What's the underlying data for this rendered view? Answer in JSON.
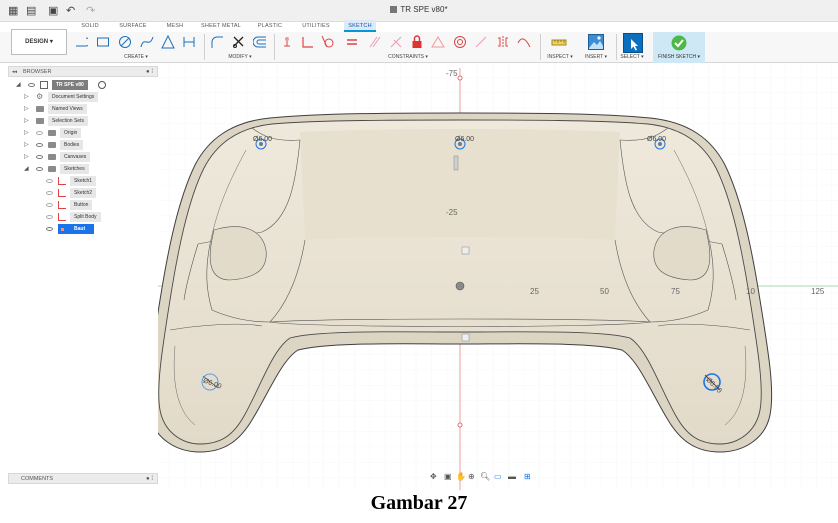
{
  "app": {
    "document_title": "TR SPE v80*",
    "design_label": "DESIGN"
  },
  "tabs": [
    {
      "label": "SOLID",
      "active": false
    },
    {
      "label": "SURFACE",
      "active": false
    },
    {
      "label": "MESH",
      "active": false
    },
    {
      "label": "SHEET METAL",
      "active": false
    },
    {
      "label": "PLASTIC",
      "active": false
    },
    {
      "label": "UTILITIES",
      "active": false
    },
    {
      "label": "SKETCH",
      "active": true
    }
  ],
  "toolbar_groups": {
    "create": "CREATE",
    "modify": "MODIFY",
    "constraints": "CONSTRAINTS",
    "inspect": "INSPECT",
    "insert": "INSERT",
    "select": "SELECT",
    "finish_sketch": "FINISH SKETCH"
  },
  "browser": {
    "title": "BROWSER",
    "root": "TR SPE v80",
    "items": [
      {
        "label": "Document Settings",
        "icon": "gear-icon"
      },
      {
        "label": "Named Views",
        "icon": "folder-icon"
      },
      {
        "label": "Selection Sets",
        "icon": "folder-icon"
      },
      {
        "label": "Origin",
        "icon": "folder-icon"
      },
      {
        "label": "Bodies",
        "icon": "folder-icon"
      },
      {
        "label": "Canvases",
        "icon": "folder-icon"
      },
      {
        "label": "Sketches",
        "icon": "folder-icon"
      }
    ],
    "sketches": [
      {
        "label": "Sketch1"
      },
      {
        "label": "Sketch2"
      },
      {
        "label": "Button"
      },
      {
        "label": "Split Body"
      },
      {
        "label": "Baut",
        "selected": true
      }
    ]
  },
  "comments": {
    "title": "COMMENTS"
  },
  "canvas": {
    "ruler_labels": {
      "y_top": "-75",
      "y_mid": "-25",
      "x_25": "25",
      "x_50": "50",
      "x_75": "75",
      "x_100": "10",
      "x_125": "125"
    },
    "dimensions": {
      "dim_left_top": "Ø6.00",
      "dim_center_top": "Ø6.00",
      "dim_right_top": "Ø6.00",
      "dim_left_bottom": "Ø6.00",
      "dim_right_bottom": "Ø6.00"
    }
  },
  "colors": {
    "accent": "#0696d7",
    "body_fill": "#e6dfd0",
    "body_stroke": "#4a4a4a",
    "axis_green": "#7cc47c",
    "axis_red": "#d9534f",
    "selection": "#1a73e8",
    "finish": "#4db848"
  },
  "caption": "Gambar 27"
}
